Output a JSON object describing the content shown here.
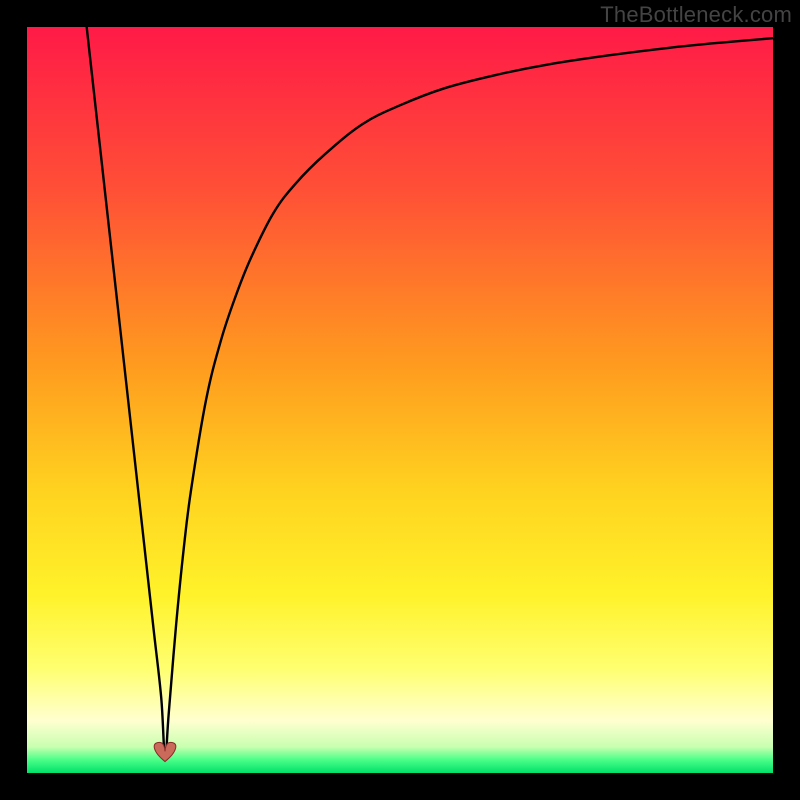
{
  "watermark": {
    "text": "TheBottleneck.com"
  },
  "chart_data": {
    "type": "line",
    "title": "",
    "xlabel": "",
    "ylabel": "",
    "xlim": [
      0,
      100
    ],
    "ylim": [
      0,
      100
    ],
    "grid": false,
    "legend": false,
    "background_gradient": {
      "stops": [
        {
          "pct": 0,
          "color": "#ff1a47"
        },
        {
          "pct": 22,
          "color": "#ff5036"
        },
        {
          "pct": 45,
          "color": "#ff9a1f"
        },
        {
          "pct": 62,
          "color": "#ffd21f"
        },
        {
          "pct": 76,
          "color": "#fff22a"
        },
        {
          "pct": 86,
          "color": "#ffff70"
        },
        {
          "pct": 93,
          "color": "#ffffd0"
        },
        {
          "pct": 96.5,
          "color": "#c8ffb0"
        },
        {
          "pct": 98.2,
          "color": "#4cff88"
        },
        {
          "pct": 100,
          "color": "#00e06a"
        }
      ]
    },
    "optimum_x": 18.5,
    "marker": {
      "x": 18.5,
      "y": 2.5,
      "color": "#c96a5a",
      "shape": "heart"
    },
    "series": [
      {
        "name": "bottleneck-curve",
        "x": [
          8,
          9,
          10,
          11,
          12,
          13,
          14,
          15,
          16,
          17,
          18,
          18.5,
          19,
          20,
          21,
          22,
          24,
          26,
          28,
          30,
          33,
          36,
          40,
          45,
          50,
          56,
          63,
          70,
          78,
          86,
          93,
          100
        ],
        "y": [
          100,
          91,
          82,
          73,
          64,
          55,
          46,
          37,
          28,
          19,
          10,
          2,
          8,
          20,
          30,
          38,
          50,
          58,
          64,
          69,
          75,
          79,
          83,
          87,
          89.5,
          91.8,
          93.6,
          95,
          96.2,
          97.2,
          97.9,
          98.5
        ]
      }
    ]
  }
}
